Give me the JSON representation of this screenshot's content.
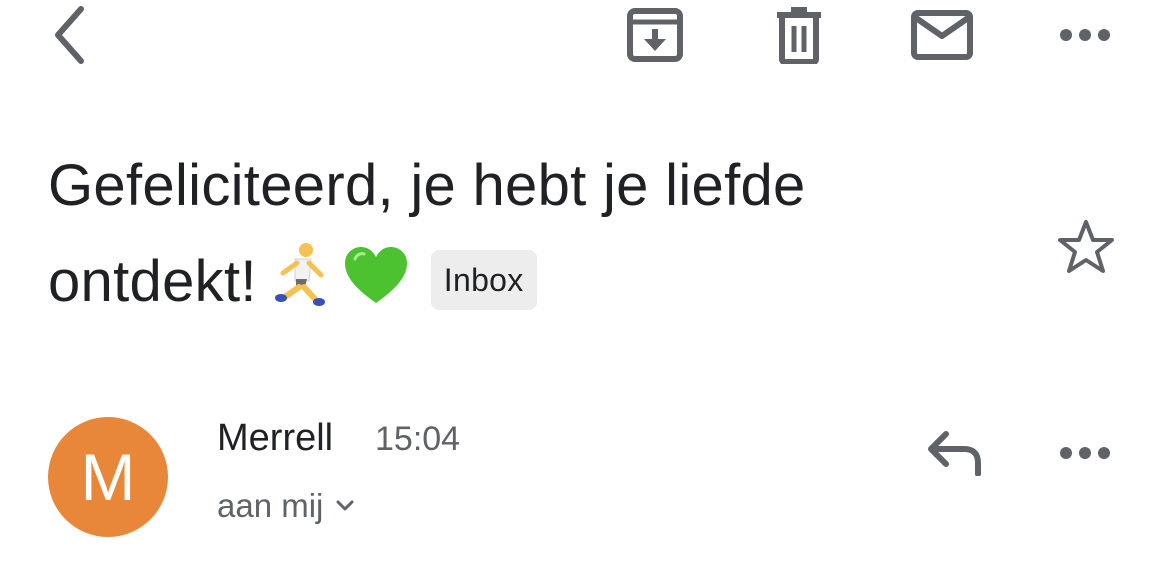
{
  "toolbar": {
    "back_icon": "chevron-left-icon",
    "archive_icon": "archive-icon",
    "delete_icon": "trash-icon",
    "mark_unread_icon": "envelope-icon",
    "more_icon": "more-horizontal-icon",
    "icon_color": "#5f6368"
  },
  "email": {
    "subject": "Gefeliciteerd, je hebt je liefde ontdekt!",
    "subject_emojis": [
      "person-running-emoji",
      "green-heart-emoji"
    ],
    "label": "Inbox",
    "star_icon": "star-outline-icon"
  },
  "message": {
    "avatar_letter": "M",
    "avatar_color": "#e8873a",
    "sender": "Merrell",
    "time": "15:04",
    "recipient": "aan mij",
    "recipient_expand_icon": "chevron-down-icon",
    "reply_icon": "reply-icon",
    "more_icon": "more-horizontal-icon"
  }
}
